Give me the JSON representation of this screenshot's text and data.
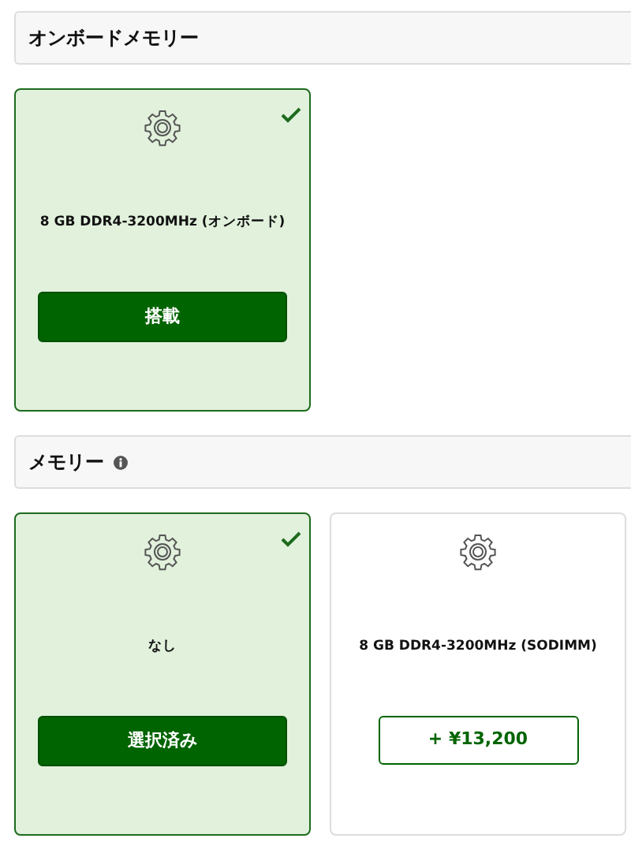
{
  "sections": [
    {
      "title": "オンボードメモリー",
      "info": false,
      "options": [
        {
          "name": "8 GB DDR4-3200MHz (オンボード)",
          "selected": true,
          "button": "搭載"
        }
      ]
    },
    {
      "title": "メモリー",
      "info": true,
      "options": [
        {
          "name": "なし",
          "selected": true,
          "button": "選択済み"
        },
        {
          "name": "8 GB DDR4-3200MHz (SODIMM)",
          "selected": false,
          "button": "+ ¥13,200"
        }
      ]
    }
  ]
}
